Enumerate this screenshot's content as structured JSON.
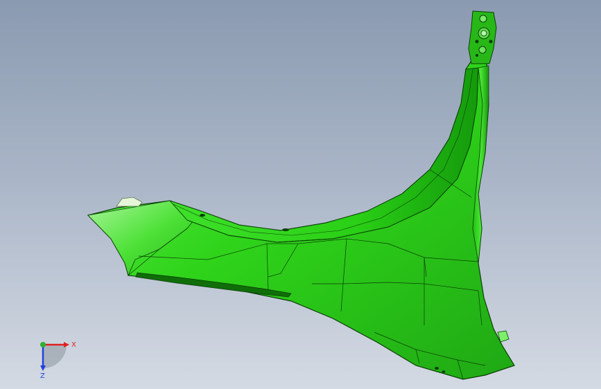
{
  "triad": {
    "x_label": "X",
    "z_label": "Z"
  },
  "colors": {
    "part": "#2fd41a",
    "part_light": "#7cf06a",
    "part_dark": "#128c0a",
    "edge": "#0a3d06",
    "x_axis": "#e02020",
    "y_axis": "#2fb02f",
    "z_axis": "#2040e0"
  }
}
